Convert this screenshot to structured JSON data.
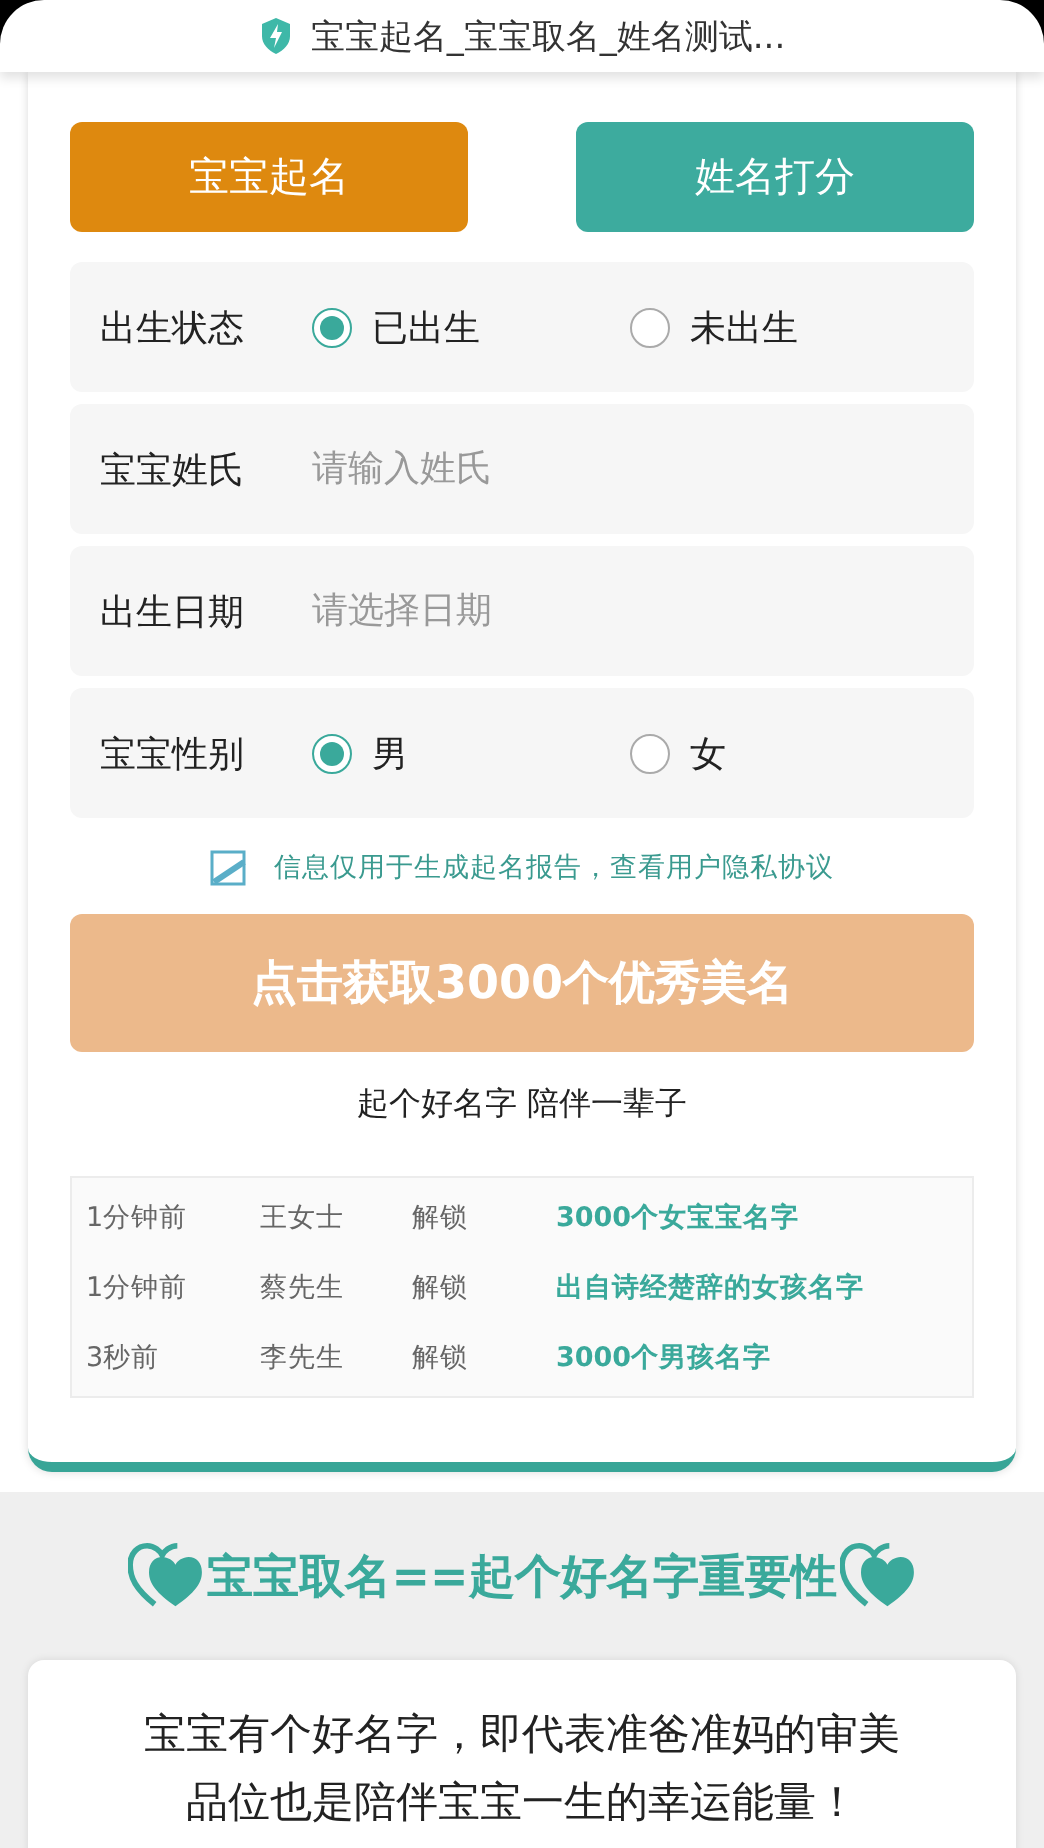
{
  "title_bar": {
    "title": "宝宝起名_宝宝取名_姓名测试..."
  },
  "tabs": [
    {
      "label": "宝宝起名",
      "selected": true
    },
    {
      "label": "姓名打分",
      "selected": false
    }
  ],
  "form_rows": [
    {
      "kind": "radio",
      "label": "出生状态",
      "options": [
        {
          "label": "已出生",
          "selected": true
        },
        {
          "label": "未出生",
          "selected": false
        }
      ]
    },
    {
      "kind": "input",
      "label": "宝宝姓氏",
      "placeholder": "请输入姓氏"
    },
    {
      "kind": "input",
      "label": "出生日期",
      "placeholder": "请选择日期"
    },
    {
      "kind": "radio",
      "label": "宝宝性别",
      "options": [
        {
          "label": "男",
          "selected": true
        },
        {
          "label": "女",
          "selected": false
        }
      ]
    }
  ],
  "agreement": {
    "checked": true,
    "text": "信息仅用于生成起名报告，查看用户隐私协议"
  },
  "submit_button": "点击获取3000个优秀美名",
  "slogan": "起个好名字 陪伴一辈子",
  "activity_feed": [
    {
      "time": "1分钟前",
      "user": "王女士",
      "action": "解锁",
      "item": "3000个女宝宝名字"
    },
    {
      "time": "1分钟前",
      "user": "蔡先生",
      "action": "解锁",
      "item": "出自诗经楚辞的女孩名字"
    },
    {
      "time": "3秒前",
      "user": "李先生",
      "action": "解锁",
      "item": "3000个男孩名字"
    }
  ],
  "section_heading": "宝宝取名==起个好名字重要性",
  "intro_text": "宝宝有个好名字，即代表准爸准妈的审美品位也是陪伴宝宝一生的幸运能量！"
}
